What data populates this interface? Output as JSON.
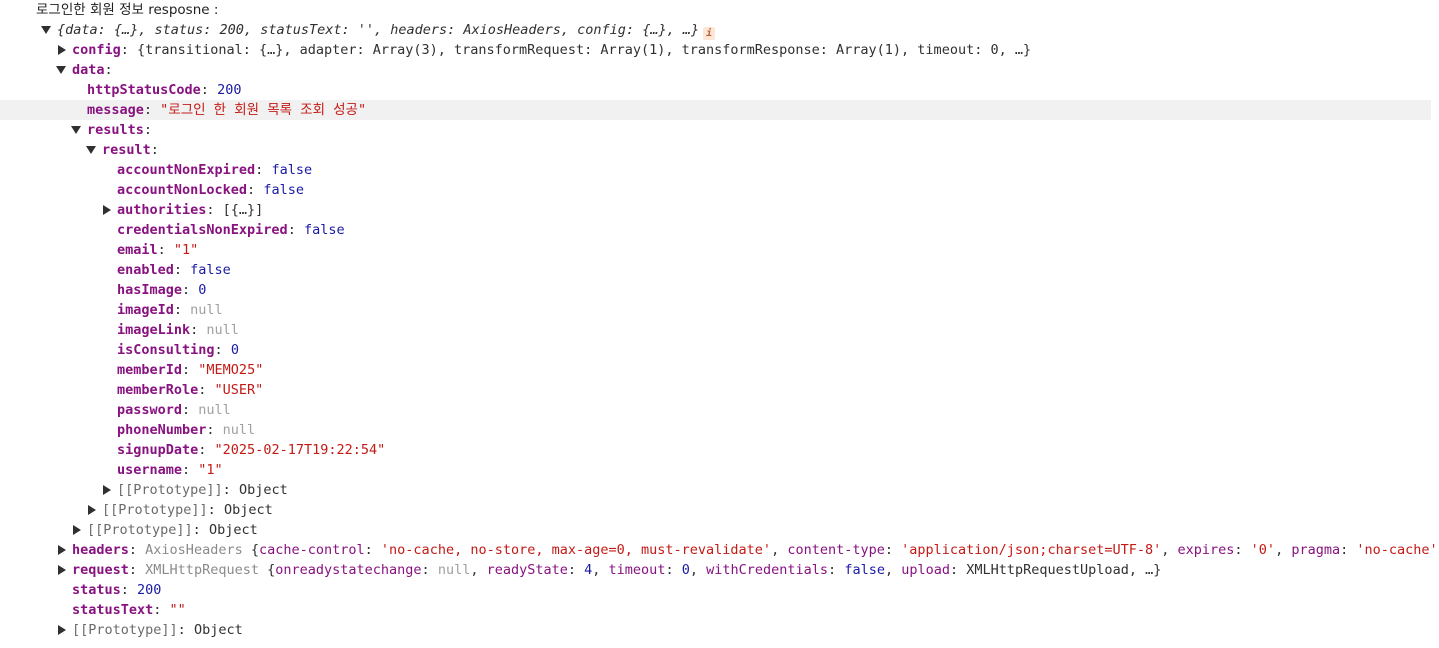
{
  "log": {
    "label": "로그인한 회원 정보 resposne :",
    "preview": "{data: {…}, status: 200, statusText: '', headers: AxiosHeaders, config: {…}, …}",
    "info_icon": "i"
  },
  "config": {
    "key": "config",
    "preview": "{transitional: {…}, adapter: Array(3), transformRequest: Array(1), transformResponse: Array(1), timeout: 0, …}"
  },
  "data": {
    "key": "data",
    "httpStatusCode": {
      "key": "httpStatusCode",
      "value": "200"
    },
    "message": {
      "key": "message",
      "value": "\"로그인 한 회원 목록 조회 성공\""
    },
    "results": {
      "key": "results",
      "result": {
        "key": "result",
        "fields": [
          {
            "key": "accountNonExpired",
            "value": "false",
            "type": "bool"
          },
          {
            "key": "accountNonLocked",
            "value": "false",
            "type": "bool"
          },
          {
            "key": "authorities",
            "value": "[{…}]",
            "type": "obj",
            "expandable": true
          },
          {
            "key": "credentialsNonExpired",
            "value": "false",
            "type": "bool"
          },
          {
            "key": "email",
            "value": "\"1\"",
            "type": "str"
          },
          {
            "key": "enabled",
            "value": "false",
            "type": "bool"
          },
          {
            "key": "hasImage",
            "value": "0",
            "type": "num"
          },
          {
            "key": "imageId",
            "value": "null",
            "type": "null"
          },
          {
            "key": "imageLink",
            "value": "null",
            "type": "null"
          },
          {
            "key": "isConsulting",
            "value": "0",
            "type": "num"
          },
          {
            "key": "memberId",
            "value": "\"MEMO25\"",
            "type": "str"
          },
          {
            "key": "memberRole",
            "value": "\"USER\"",
            "type": "str"
          },
          {
            "key": "password",
            "value": "null",
            "type": "null"
          },
          {
            "key": "phoneNumber",
            "value": "null",
            "type": "null"
          },
          {
            "key": "signupDate",
            "value": "\"2025-02-17T19:22:54\"",
            "type": "str"
          },
          {
            "key": "username",
            "value": "\"1\"",
            "type": "str"
          }
        ],
        "prototype": {
          "key": "[[Prototype]]",
          "value": "Object"
        }
      },
      "prototype": {
        "key": "[[Prototype]]",
        "value": "Object"
      }
    },
    "prototype": {
      "key": "[[Prototype]]",
      "value": "Object"
    }
  },
  "headers": {
    "key": "headers",
    "class": "AxiosHeaders",
    "entries": [
      {
        "k": "cache-control",
        "v": "'no-cache, no-store, max-age=0, must-revalidate'"
      },
      {
        "k": "content-type",
        "v": "'application/json;charset=UTF-8'"
      },
      {
        "k": "expires",
        "v": "'0'"
      },
      {
        "k": "pragma",
        "v": "'no-cache'"
      }
    ]
  },
  "request": {
    "key": "request",
    "class": "XMLHttpRequest",
    "entries": [
      {
        "k": "onreadystatechange",
        "v": "null",
        "type": "null"
      },
      {
        "k": "readyState",
        "v": "4",
        "type": "num"
      },
      {
        "k": "timeout",
        "v": "0",
        "type": "num"
      },
      {
        "k": "withCredentials",
        "v": "false",
        "type": "bool"
      },
      {
        "k": "upload",
        "v": "XMLHttpRequestUpload",
        "type": "obj"
      }
    ]
  },
  "status": {
    "key": "status",
    "value": "200"
  },
  "statusText": {
    "key": "statusText",
    "value": "\"\""
  },
  "prototype": {
    "key": "[[Prototype]]",
    "value": "Object"
  },
  "colors": {
    "key": "#881280",
    "string": "#c41a16",
    "number": "#1a1aa6",
    "null": "#a0a0a0",
    "highlight_row": "#f1f1f1",
    "info_badge": "#fde6d6"
  }
}
